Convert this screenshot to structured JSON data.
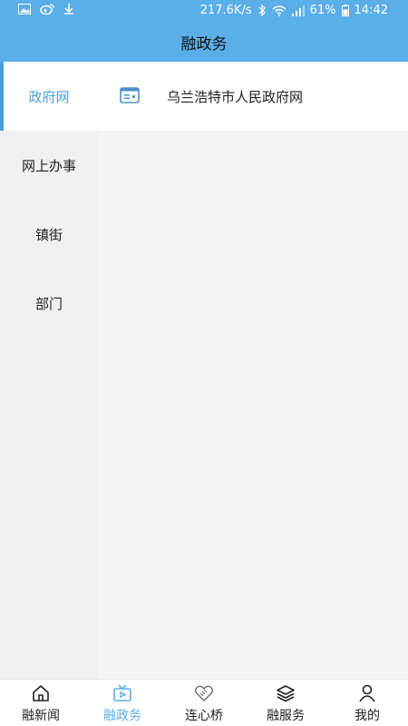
{
  "status_bar": {
    "speed": "217.6K/s",
    "battery": "61%",
    "time": "14:42",
    "icons": [
      "image-icon",
      "weibo-icon",
      "download-icon",
      "bluetooth-icon",
      "wifi-icon",
      "signal-icon",
      "battery-icon"
    ]
  },
  "header": {
    "title": "融政务"
  },
  "sidebar": {
    "items": [
      {
        "label": "政府网",
        "active": true
      },
      {
        "label": "网上办事",
        "active": false
      },
      {
        "label": "镇街",
        "active": false
      },
      {
        "label": "部门",
        "active": false
      }
    ]
  },
  "content": {
    "items": [
      {
        "label": "乌兰浩特市人民政府网",
        "icon": "id-card-icon"
      }
    ]
  },
  "tabbar": {
    "items": [
      {
        "label": "融新闻",
        "icon": "home-icon",
        "active": false
      },
      {
        "label": "融政务",
        "icon": "tv-icon",
        "active": true
      },
      {
        "label": "连心桥",
        "icon": "handshake-icon",
        "active": false
      },
      {
        "label": "融服务",
        "icon": "layers-icon",
        "active": false
      },
      {
        "label": "我的",
        "icon": "user-icon",
        "active": false
      }
    ]
  },
  "colors": {
    "accent": "#5aafe9",
    "active_text": "#4a9fd9"
  }
}
